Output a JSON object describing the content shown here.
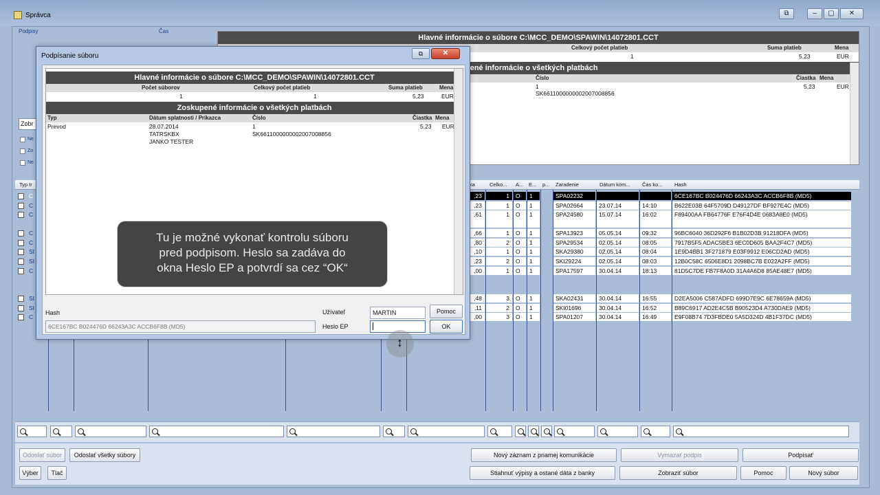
{
  "window": {
    "title": "Správca",
    "min": "–",
    "max": "▢",
    "close": "✕",
    "extra": "⧉"
  },
  "headers": {
    "signatures": "Podpisy",
    "time": "Čas"
  },
  "info_panel": {
    "title": "Hlavné informácie o súbore C:\\MCC_DEMO\\SPAWIN\\14072801.CCT",
    "col_total_count": "Celkový počet platieb",
    "col_sum": "Suma platieb",
    "col_currency": "Mena",
    "total_count": "1",
    "sum": "5,23",
    "currency": "EUR",
    "group_title": "pené informácie o všetkých platbách",
    "col_number": "Číslo",
    "col_amount": "Čiastka",
    "col_currency2": "Mena",
    "row_number_1": "1",
    "row_number_2": "SK6611000000002007008856",
    "row_amount": "5,23",
    "row_currency": "EUR"
  },
  "left_panel": {
    "filter_value": "Zobr",
    "checks": [
      "Ne",
      "Zo",
      "Ne"
    ]
  },
  "grid": {
    "headers": [
      "Typ tr",
      "ťka",
      "Celko...",
      "A...",
      "E...",
      "p...",
      "Zaradenie",
      "Dátum kom...",
      "Čas ko...",
      "Hash"
    ],
    "rows": [
      {
        "t": "C",
        "a": ",23",
        "c": "1",
        "s": "O",
        "e": "1",
        "z": "SPA02232",
        "d": "",
        "h": "",
        "hash": "6CE167BC B024476D 66243A3C ACCB6F8B (MD5)"
      },
      {
        "t": "C",
        "a": ",23",
        "c": "1",
        "s": "O",
        "e": "1",
        "z": "SPA02664",
        "d": "23.07.14",
        "h": "14:10",
        "hash": "B622E03B 64F5709D D49127DF BF927E4C (MD5)"
      },
      {
        "t": "C",
        "a": ",61",
        "c": "1",
        "s": "O",
        "e": "1",
        "z": "SPA24580",
        "d": "15.07.14",
        "h": "16:02",
        "hash": "F89400AA FB64776F E76F4D4E 0683A8E0 (MD5)"
      },
      {
        "t": "C",
        "a": ",66",
        "c": "1",
        "s": "O",
        "e": "1",
        "z": "SPA13923",
        "d": "05.05.14",
        "h": "09:32",
        "hash": "96BC6040 36D292F6 B1B02D3B 91218DFA (MD5)"
      },
      {
        "t": "C",
        "a": ",80",
        "c": "2",
        "s": "O",
        "e": "1",
        "z": "SPA29534",
        "d": "02.05.14",
        "h": "08:05",
        "hash": "7917B5F5 ADAC5BE3 6EC0D605 BAA2F4C7 (MD5)"
      },
      {
        "t": "SI",
        "a": ",10",
        "c": "1",
        "s": "O",
        "e": "1",
        "z": "SKA29380",
        "d": "02.05.14",
        "h": "08:04",
        "hash": "1E9D4BB1 3F271879 E03F9912 E06CD2AD (MD5)"
      },
      {
        "t": "SI",
        "a": ",23",
        "c": "2",
        "s": "O",
        "e": "1",
        "z": "SKI29224",
        "d": "02.05.14",
        "h": "08:03",
        "hash": "12B0C58C 6506E8D1 2098BC7B E022A2FF (MD5)"
      },
      {
        "t": "C",
        "a": ",00",
        "c": "1",
        "s": "O",
        "e": "1",
        "z": "SPA17597",
        "d": "30.04.14",
        "h": "18:13",
        "hash": "81D5C7DE FB7F8A0D 31A4A6D8 85AE48E7 (MD5)"
      },
      {
        "t": "SI",
        "a": ",48",
        "c": "3",
        "s": "O",
        "e": "1",
        "z": "SKA02431",
        "d": "30.04.14",
        "h": "16:55",
        "hash": "D2EA5006 C587ADFD 699D7E9C 6E78659A (MD5)"
      },
      {
        "t": "SI",
        "a": ",11",
        "c": "2",
        "s": "O",
        "e": "1",
        "z": "SKI01696",
        "d": "30.04.14",
        "h": "16:52",
        "hash": "B89C6917 AD2E4C5B B90523D4 A730DAE9 (MD5)"
      },
      {
        "t": "C",
        "a": ",00",
        "c": "3",
        "s": "O",
        "e": "1",
        "z": "SPA01207",
        "d": "30.04.14",
        "h": "16:49",
        "hash": "E9F08B74 7D3FBDE0 5A5D324D 4B1F37DC (MD5)"
      }
    ]
  },
  "buttons": {
    "send_file": "Odoslať súbor",
    "send_all": "Odoslať všetky súbory",
    "select": "Výber",
    "print": "Tlač",
    "new_record": "Nový záznam z priamej komunikácie",
    "delete_sig": "Vymazať podpis",
    "sign": "Podpísať",
    "download": "Stiahnuť výpisy a ostané dáta z banky",
    "show_file": "Zobraziť súbor",
    "help": "Pomoc",
    "new_file": "Nový súbor"
  },
  "dialog": {
    "title": "Podpísanie súboru",
    "restore": "⧉",
    "close": "✕",
    "main_title": "Hlavné informácie o súbore C:\\MCC_DEMO\\SPAWIN\\14072801.CCT",
    "col_file_count": "Počet súborov",
    "col_total": "Celkový počet platieb",
    "col_sum": "Suma platieb",
    "col_cur": "Mena",
    "file_count": "1",
    "total": "1",
    "sum": "5,23",
    "cur": "EUR",
    "group_title": "Zoskupené informácie o všetkých platbách",
    "g_col_type": "Typ",
    "g_col_date": "Dátum splatnosti / Príkazca",
    "g_col_number": "Číslo",
    "g_col_amount": "Čiastka",
    "g_col_cur": "Mena",
    "g_type": "Prevod",
    "g_date": "28.07.2014",
    "g_bank": "TATRSKBX",
    "g_payer": "JANKO TESTER",
    "g_num1": "1",
    "g_num2": "SK6611000000002007008856",
    "g_amount": "5,23",
    "g_cur": "EUR",
    "hash_label": "Hash",
    "hash_value": "6CE167BC B024476D 66243A3C ACCB6F8B (MD5)",
    "user_label": "Užívateľ",
    "user_value": "MARTIN",
    "pass_label": "Heslo EP",
    "help_btn": "Pomoc",
    "ok_btn": "OK"
  },
  "tooltip": {
    "line1": "Tu je možné vykonať kontrolu súboru",
    "line2": "pred podpisom. Heslo sa zadáva do",
    "line3": "okna Heslo EP a potvrdí sa cez “OK“"
  }
}
